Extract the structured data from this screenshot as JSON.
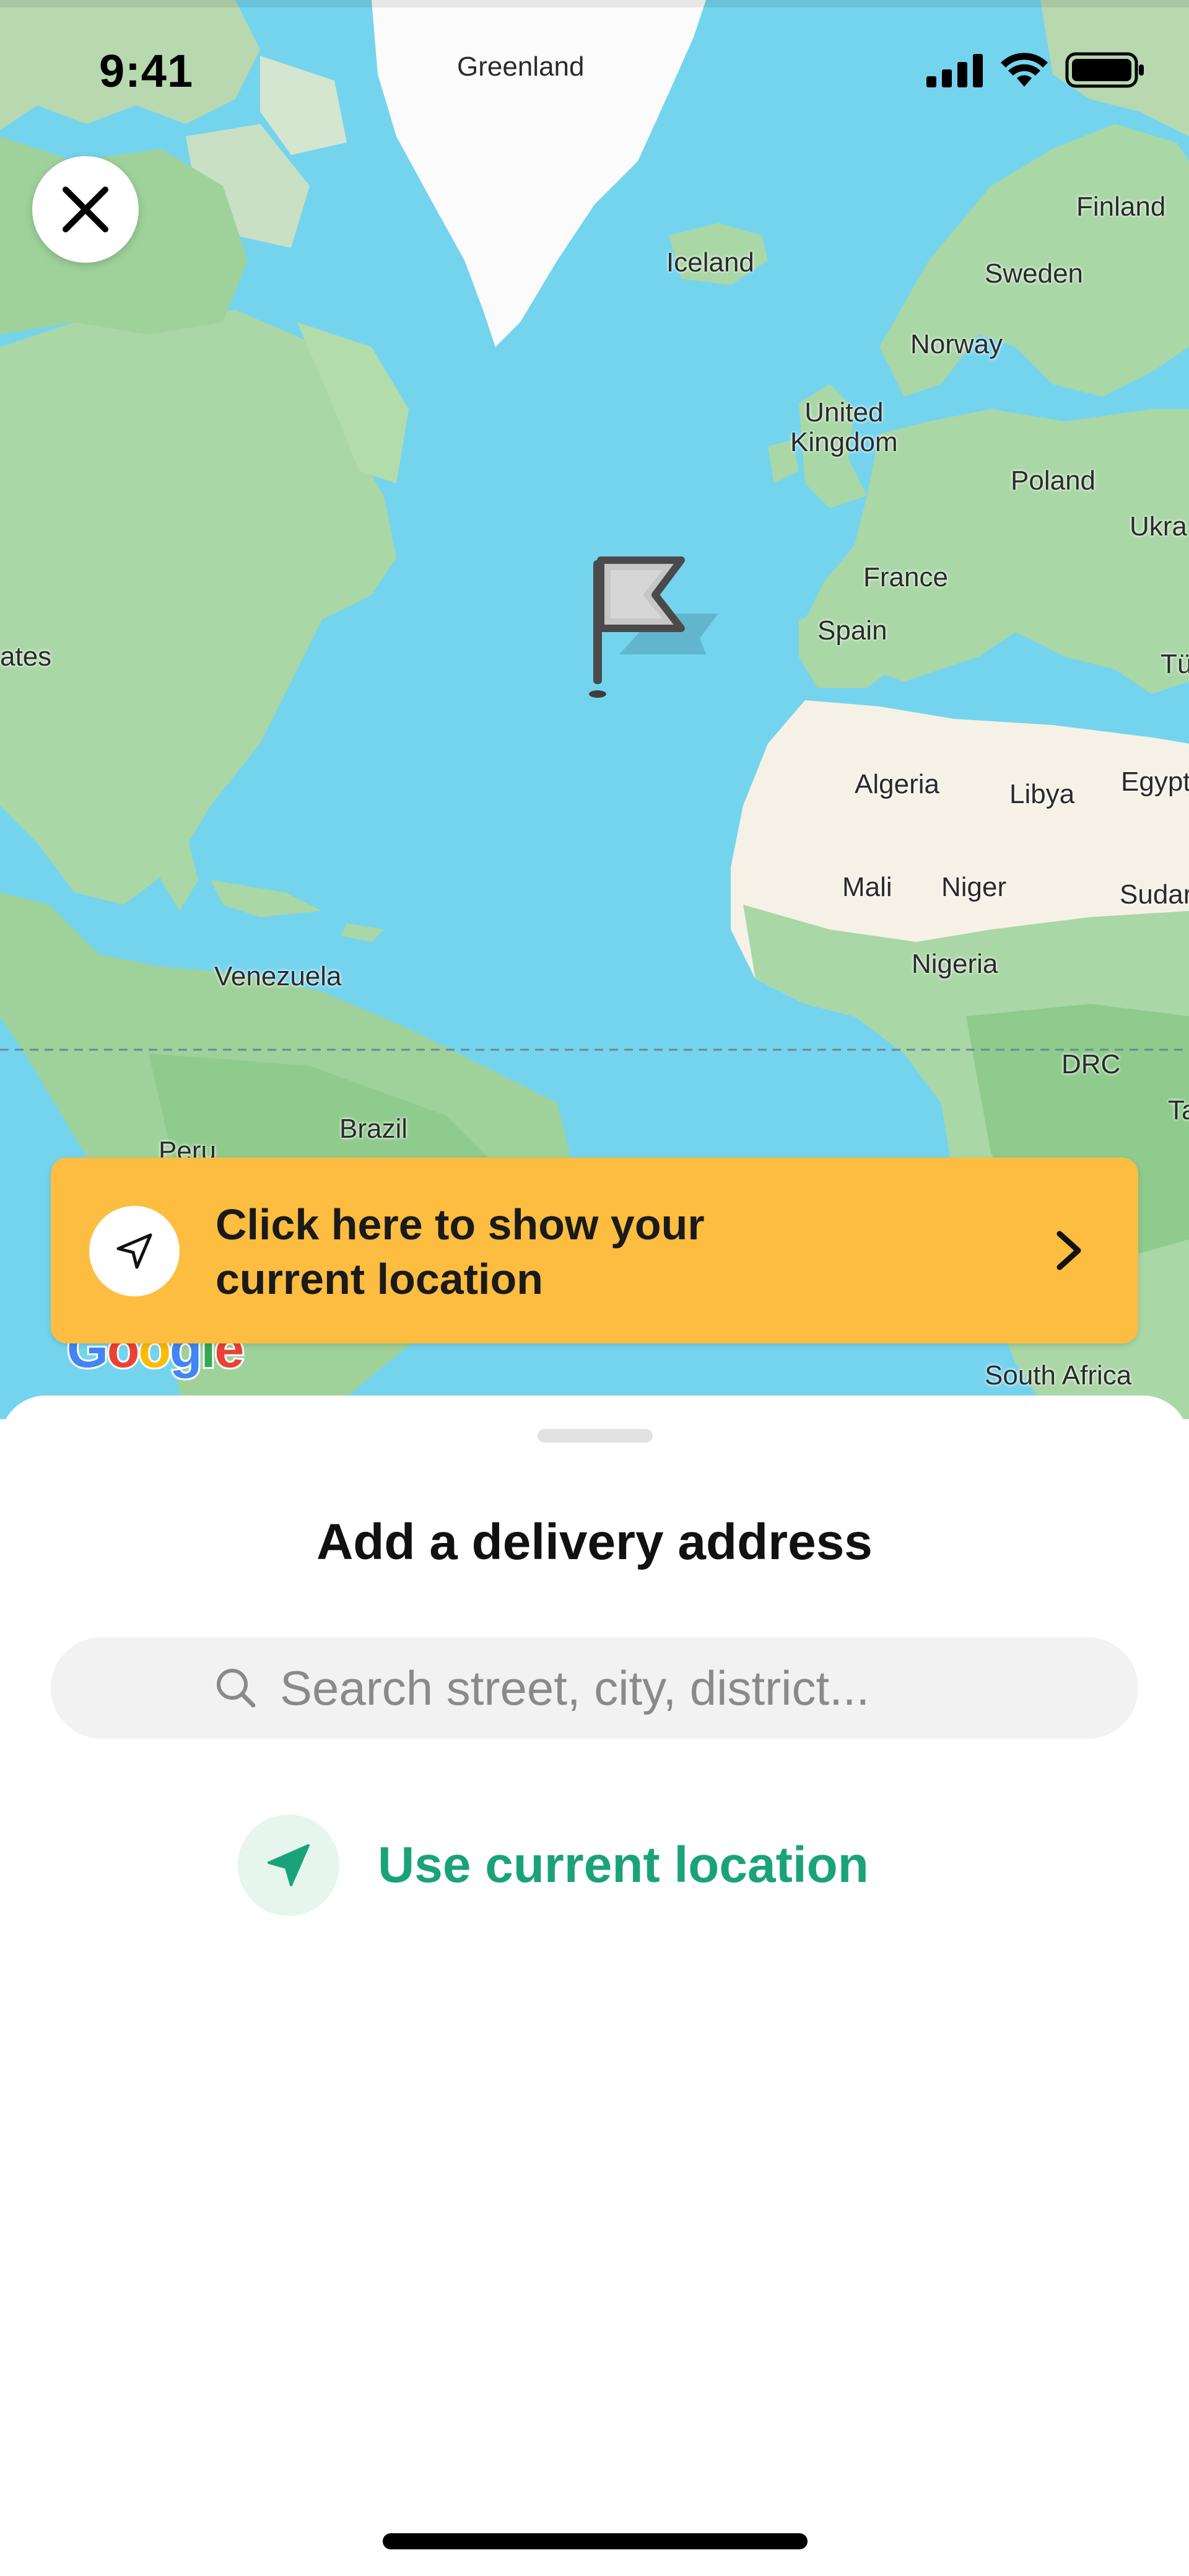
{
  "status_bar": {
    "time": "9:41"
  },
  "map": {
    "labels": [
      {
        "id": "greenland",
        "text": "Greenland"
      },
      {
        "id": "iceland",
        "text": "Iceland"
      },
      {
        "id": "finland",
        "text": "Finland"
      },
      {
        "id": "sweden",
        "text": "Sweden"
      },
      {
        "id": "norway",
        "text": "Norway"
      },
      {
        "id": "united-kingdom",
        "text": "United\nKingdom"
      },
      {
        "id": "poland",
        "text": "Poland"
      },
      {
        "id": "ukraine",
        "text": "Ukra"
      },
      {
        "id": "france",
        "text": "France"
      },
      {
        "id": "spain",
        "text": "Spain"
      },
      {
        "id": "turkey",
        "text": "Tü"
      },
      {
        "id": "states",
        "text": "ates"
      },
      {
        "id": "algeria",
        "text": "Algeria"
      },
      {
        "id": "libya",
        "text": "Libya"
      },
      {
        "id": "egypt",
        "text": "Egypt"
      },
      {
        "id": "mali",
        "text": "Mali"
      },
      {
        "id": "niger",
        "text": "Niger"
      },
      {
        "id": "sudan",
        "text": "Sudar"
      },
      {
        "id": "nigeria",
        "text": "Nigeria"
      },
      {
        "id": "venezuela",
        "text": "Venezuela"
      },
      {
        "id": "drc",
        "text": "DRC"
      },
      {
        "id": "tanzania",
        "text": "Ta"
      },
      {
        "id": "brazil",
        "text": "Brazil"
      },
      {
        "id": "peru",
        "text": "Peru"
      },
      {
        "id": "south-africa",
        "text": "South Africa"
      }
    ],
    "google_logo": "Google"
  },
  "banner": {
    "line1": "Click here to show your",
    "line2": "current location"
  },
  "sheet": {
    "title": "Add a delivery address",
    "search_placeholder": "Search street, city, district...",
    "use_location_label": "Use current location"
  },
  "colors": {
    "ocean": "#74d4ee",
    "banner": "#fcbd40",
    "accent_green": "#1aa378"
  }
}
